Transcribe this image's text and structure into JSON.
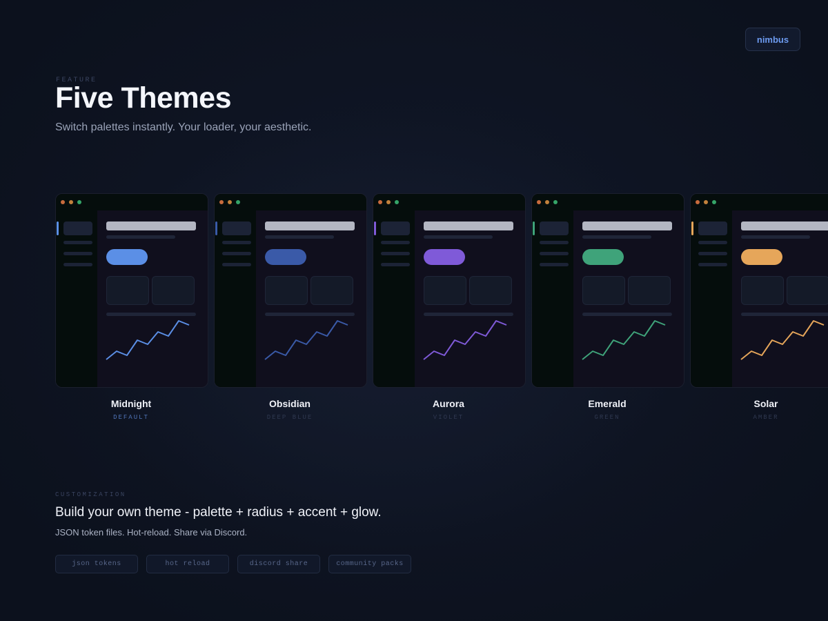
{
  "brand": {
    "label": "nimbus"
  },
  "header": {
    "eyebrow": "FEATURE",
    "title": "Five Themes",
    "subtitle": "Switch palettes instantly. Your loader, your aesthetic."
  },
  "themes": [
    {
      "name": "Midnight",
      "tag": "DEFAULT",
      "accent": "#5b8fe6",
      "active": true
    },
    {
      "name": "Obsidian",
      "tag": "DEEP BLUE",
      "accent": "#3a5aa8",
      "active": false
    },
    {
      "name": "Aurora",
      "tag": "VIOLET",
      "accent": "#7f5ad8",
      "active": false
    },
    {
      "name": "Emerald",
      "tag": "GREEN",
      "accent": "#3fa37a",
      "active": false
    },
    {
      "name": "Solar",
      "tag": "AMBER",
      "accent": "#e6a65a",
      "active": false
    }
  ],
  "customization": {
    "eyebrow": "CUSTOMIZATION",
    "title": "Build your own theme - palette + radius + accent + glow.",
    "description": "JSON token files. Hot-reload. Share via Discord.",
    "chips": [
      "json tokens",
      "hot reload",
      "discord share",
      "community packs"
    ]
  }
}
